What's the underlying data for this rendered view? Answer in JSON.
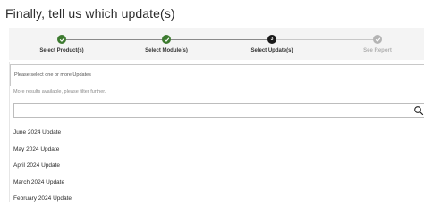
{
  "header": {
    "title": "Finally, tell us which update(s)"
  },
  "stepper": {
    "steps": [
      {
        "label": "Select Product(s)",
        "state": "done",
        "icon": "checkmark-icon"
      },
      {
        "label": "Select Module(s)",
        "state": "done",
        "icon": "checkmark-icon"
      },
      {
        "label": "Select Update(s)",
        "state": "current",
        "number": "3"
      },
      {
        "label": "See Report",
        "state": "pending",
        "icon": "checkmark-icon"
      }
    ],
    "colors": {
      "done": "#3c7a2f",
      "current": "#1a1a1a",
      "pending": "#b4b4b4"
    }
  },
  "update_select": {
    "placeholder": "Please select one or more Updates",
    "more_results_hint": "More results available, please filter further.",
    "search": {
      "value": "",
      "icon": "search-icon"
    },
    "options": [
      "June 2024 Update",
      "May 2024 Update",
      "April 2024 Update",
      "March 2024 Update",
      "February 2024 Update"
    ]
  }
}
